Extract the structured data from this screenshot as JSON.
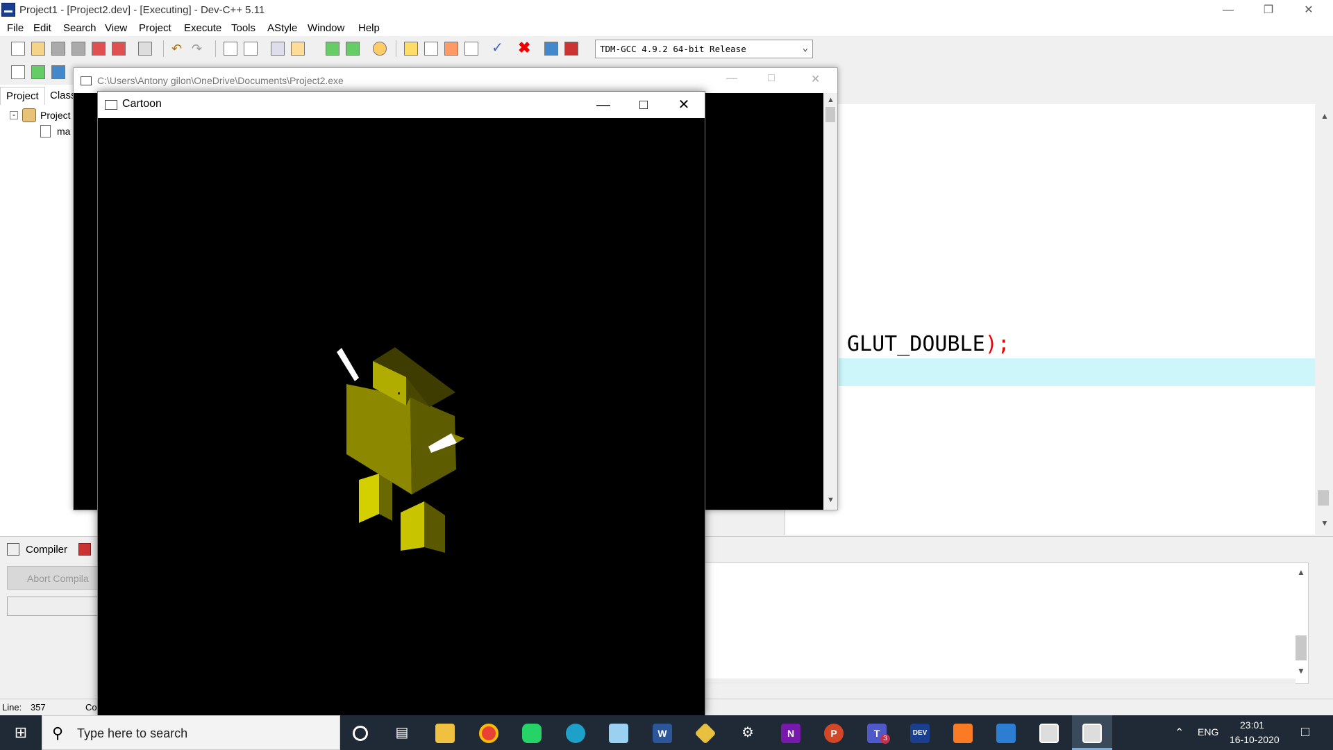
{
  "window": {
    "title": "Project1 - [Project2.dev] - [Executing] - Dev-C++ 5.11"
  },
  "menu": {
    "items": [
      "File",
      "Edit",
      "Search",
      "View",
      "Project",
      "Execute",
      "Tools",
      "AStyle",
      "Window",
      "Help"
    ]
  },
  "toolbar": {
    "compiler": "TDM-GCC 4.9.2 64-bit Release"
  },
  "left_panel": {
    "tabs": [
      "Project",
      "Class"
    ],
    "tree_root": "Project",
    "tree_child": "ma"
  },
  "editor": {
    "code_text": "GLUT_DOUBLE",
    "code_paren": ")",
    "code_semi": ";"
  },
  "bottom_panel": {
    "tab_compiler": "Compiler",
    "abort_button": "Abort Compila"
  },
  "statusbar": {
    "line_label": "Line:",
    "line_value": "357",
    "col_label": "Co"
  },
  "console": {
    "title": "C:\\Users\\Antony gilon\\OneDrive\\Documents\\Project2.exe"
  },
  "cartoon": {
    "title": "Cartoon",
    "colors": {
      "body_light": "#c8c400",
      "body_dark": "#6a6800",
      "body_mid": "#9a9600",
      "head_top": "#4a4800",
      "antenna": "#ffffff"
    }
  },
  "taskbar": {
    "search_placeholder": "Type here to search",
    "icons": [
      "task-view-icon",
      "file-explorer-icon",
      "chrome-icon",
      "whatsapp-icon",
      "edge-icon",
      "notepad-icon",
      "word-icon",
      "git-icon",
      "settings-icon",
      "onenote-icon",
      "powerpoint-icon",
      "teams-icon",
      "devcpp-icon",
      "xampp-icon",
      "photos-icon",
      "window-icon",
      "active-window-icon"
    ],
    "teams_badge": "3",
    "language": "ENG",
    "time": "23:01",
    "date": "16-10-2020"
  }
}
